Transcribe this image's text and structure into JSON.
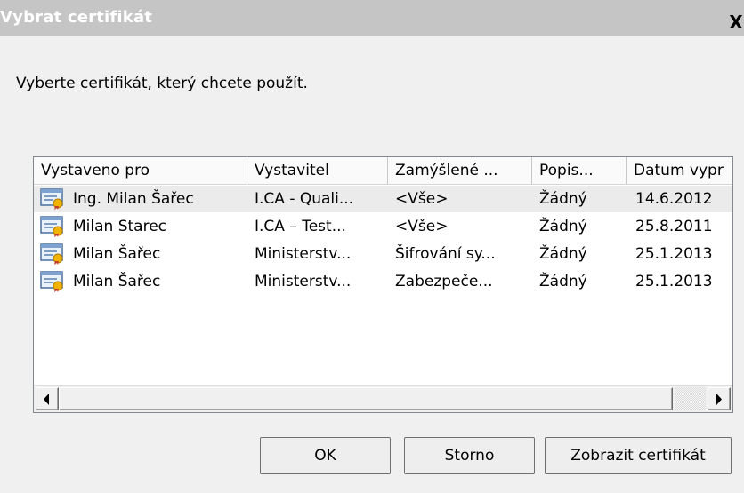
{
  "window": {
    "title": "Vybrat certifikát",
    "close_glyph": "X"
  },
  "instruction": "Vyberte certifikát, který chcete použít.",
  "columns": [
    "Vystaveno pro",
    "Vystavitel",
    "Zamýšlené ...",
    "Popis...",
    "Datum vypr"
  ],
  "rows": [
    {
      "issued_to": "Ing. Milan Šařec",
      "issuer": "I.CA - Quali...",
      "purpose": "<Vše>",
      "description": "Žádný",
      "expiry": "14.6.2012",
      "selected": true,
      "icon": "certificate-icon"
    },
    {
      "issued_to": "Milan Starec",
      "issuer": "I.CA – Test...",
      "purpose": "<Vše>",
      "description": "Žádný",
      "expiry": "25.8.2011",
      "selected": false,
      "icon": "certificate-icon"
    },
    {
      "issued_to": "Milan Šařec",
      "issuer": "Ministerstv...",
      "purpose": "Šifrování sy...",
      "description": "Žádný",
      "expiry": "25.1.2013",
      "selected": false,
      "icon": "certificate-icon"
    },
    {
      "issued_to": "Milan Šařec",
      "issuer": "Ministerstv...",
      "purpose": "Zabezpeče...",
      "description": "Žádný",
      "expiry": "25.1.2013",
      "selected": false,
      "icon": "certificate-icon"
    }
  ],
  "buttons": {
    "ok": "OK",
    "cancel": "Storno",
    "view_certificate": "Zobrazit certifikát"
  },
  "colors": {
    "titlebar": "#c5c5c5",
    "selected_row": "#ebebeb",
    "dialog_bg": "#f0f0f0"
  }
}
